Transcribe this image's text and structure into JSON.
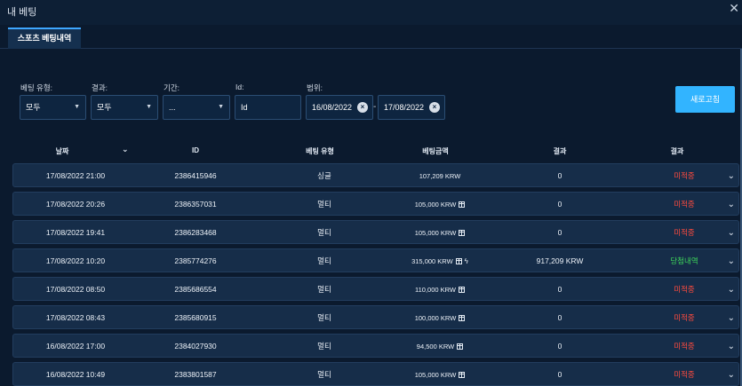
{
  "window": {
    "title": "내 베팅",
    "close_icon": "close-icon"
  },
  "tabs": [
    {
      "label": "스포츠 베팅내역",
      "active": true
    }
  ],
  "filters": {
    "bet_type": {
      "label": "베팅 유형:",
      "value": "모두"
    },
    "result": {
      "label": "결과:",
      "value": "모두"
    },
    "period": {
      "label": "기간:",
      "value": "..."
    },
    "id": {
      "label": "Id:",
      "value": "Id"
    },
    "range": {
      "label": "범위:",
      "from": "16/08/2022",
      "to": "17/08/2022",
      "separator": "-"
    },
    "refresh_label": "새로고침"
  },
  "table": {
    "headers": {
      "date": "날짜",
      "id": "ID",
      "type": "베팅 유형",
      "amount": "베팅금액",
      "payout": "결과",
      "status": "결과"
    },
    "rows": [
      {
        "date": "17/08/2022 21:00",
        "id": "2386415946",
        "type": "싱글",
        "amount": "107,209 KRW",
        "gift": false,
        "boost": false,
        "payout": "0",
        "status": "미적중",
        "status_kind": "pending"
      },
      {
        "date": "17/08/2022 20:26",
        "id": "2386357031",
        "type": "멀티",
        "amount": "105,000 KRW",
        "gift": true,
        "boost": false,
        "payout": "0",
        "status": "미적중",
        "status_kind": "pending"
      },
      {
        "date": "17/08/2022 19:41",
        "id": "2386283468",
        "type": "멀티",
        "amount": "105,000 KRW",
        "gift": true,
        "boost": false,
        "payout": "0",
        "status": "미적중",
        "status_kind": "pending"
      },
      {
        "date": "17/08/2022 10:20",
        "id": "2385774276",
        "type": "멀티",
        "amount": "315,000 KRW",
        "gift": true,
        "boost": true,
        "payout": "917,209 KRW",
        "status": "당첨내역",
        "status_kind": "win"
      },
      {
        "date": "17/08/2022 08:50",
        "id": "2385686554",
        "type": "멀티",
        "amount": "110,000 KRW",
        "gift": true,
        "boost": false,
        "payout": "0",
        "status": "미적중",
        "status_kind": "pending"
      },
      {
        "date": "17/08/2022 08:43",
        "id": "2385680915",
        "type": "멀티",
        "amount": "100,000 KRW",
        "gift": true,
        "boost": false,
        "payout": "0",
        "status": "미적중",
        "status_kind": "pending"
      },
      {
        "date": "16/08/2022 17:00",
        "id": "2384027930",
        "type": "멀티",
        "amount": "94,500 KRW",
        "gift": true,
        "boost": false,
        "payout": "0",
        "status": "미적중",
        "status_kind": "pending"
      },
      {
        "date": "16/08/2022 10:49",
        "id": "2383801587",
        "type": "멀티",
        "amount": "105,000 KRW",
        "gift": true,
        "boost": false,
        "payout": "0",
        "status": "미적중",
        "status_kind": "pending"
      }
    ]
  },
  "colors": {
    "background": "#0b1a2e",
    "accent": "#32b4ff",
    "pending": "#ff4b3e",
    "win": "#3ed65a"
  }
}
